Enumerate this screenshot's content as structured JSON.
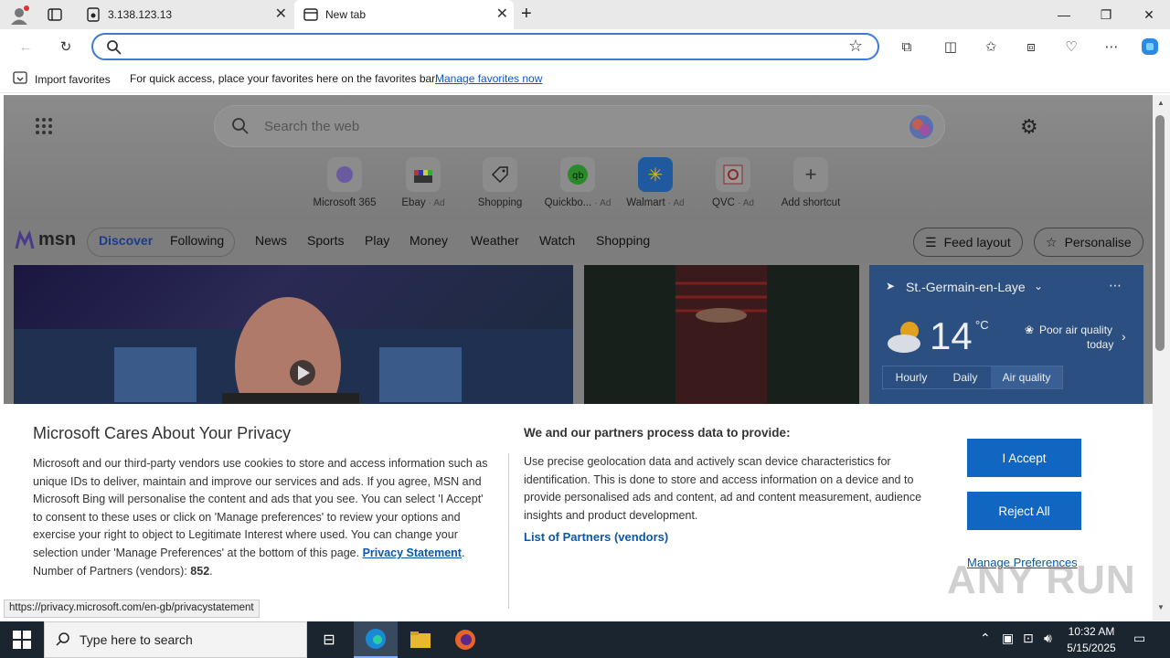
{
  "browser": {
    "tabs": [
      {
        "label": "3.138.123.13"
      },
      {
        "label": "New tab"
      }
    ],
    "address_placeholder": "",
    "favorites_bar": {
      "import_label": "Import favorites",
      "message": "For quick access, place your favorites here on the favorites bar.",
      "manage_link": "Manage favorites now"
    },
    "status_url": "https://privacy.microsoft.com/en-gb/privacystatement"
  },
  "newtab": {
    "search_placeholder": "Search the web",
    "shortcuts": [
      {
        "label": "Microsoft 365",
        "ad": ""
      },
      {
        "label": "Ebay",
        "ad": "· Ad"
      },
      {
        "label": "Shopping",
        "ad": ""
      },
      {
        "label": "Quickbo...",
        "ad": "· Ad"
      },
      {
        "label": "Walmart",
        "ad": "· Ad"
      },
      {
        "label": "QVC",
        "ad": "· Ad"
      },
      {
        "label": "Add shortcut",
        "ad": ""
      }
    ],
    "msn_logo": "msn",
    "nav": [
      "Discover",
      "Following",
      "News",
      "Sports",
      "Play",
      "Money",
      "Weather",
      "Watch",
      "Shopping"
    ],
    "feed_layout": "Feed layout",
    "personalise": "Personalise",
    "weather": {
      "location": "St.-Germain-en-Laye",
      "temp": "14",
      "unit": "°C",
      "air_quality_line1": "Poor air quality",
      "air_quality_line2": "today",
      "tabs": [
        "Hourly",
        "Daily",
        "Air quality"
      ]
    }
  },
  "privacy": {
    "title": "Microsoft Cares About Your Privacy",
    "body": "Microsoft and our third-party vendors use cookies to store and access information such as unique IDs to deliver, maintain and improve our services and ads. If you agree, MSN and Microsoft Bing will personalise the content and ads that you see. You can select 'I Accept' to consent to these uses or click on 'Manage preferences' to review your options and exercise your right to object to Legitimate Interest where used.  You can change your selection under 'Manage Preferences' at the bottom of this page.",
    "privacy_link": "Privacy Statement",
    "partners_label": "Number of Partners (vendors):",
    "partners_count": "852",
    "purposes_title": "We and our partners process data to provide:",
    "purposes_body": "Use precise geolocation data and actively scan device characteristics for identification. This is done to store and access information on a device and to provide personalised ads and content, ad and content measurement, audience insights and product development.",
    "partners_link": "List of Partners (vendors)",
    "accept": "I Accept",
    "reject": "Reject All",
    "manage": "Manage Preferences"
  },
  "watermark": "ANY RUN",
  "taskbar": {
    "search_placeholder": "Type here to search",
    "time": "10:32 AM",
    "date": "5/15/2025"
  }
}
